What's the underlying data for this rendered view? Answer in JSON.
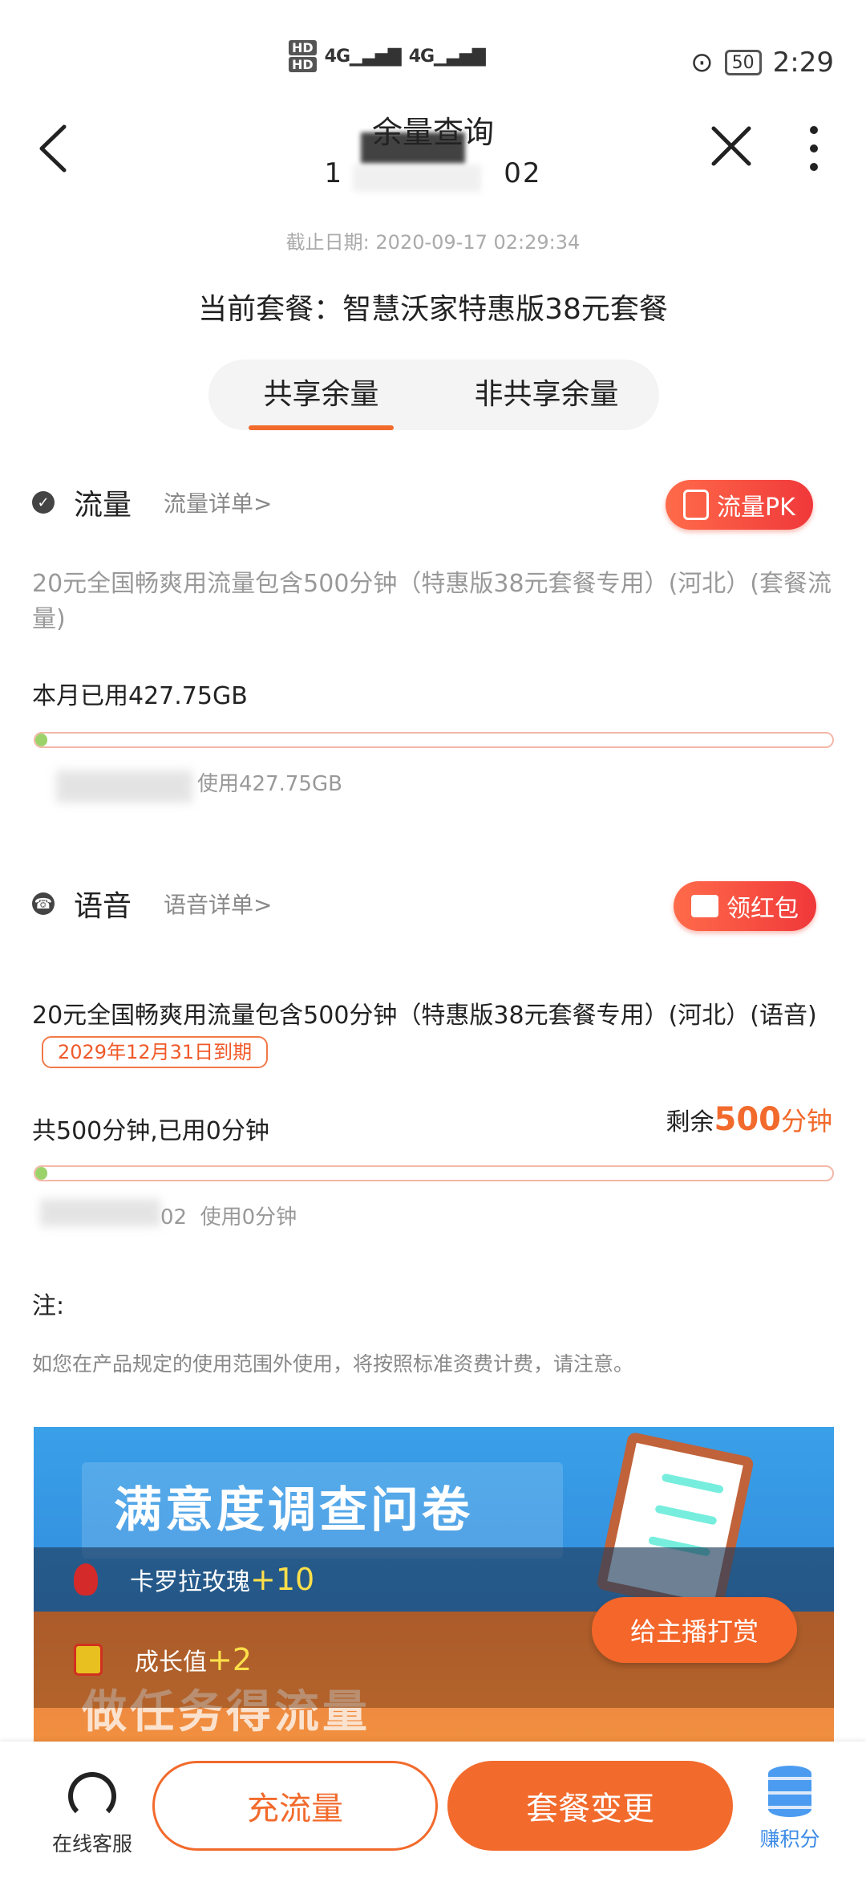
{
  "status_bar": {
    "hd1": "HD",
    "hd2": "HD",
    "signal1": "4G",
    "signal2": "4G",
    "battery": "50",
    "time": "2:29"
  },
  "header": {
    "title": "余量查询",
    "phone_start": "1",
    "phone_end": "02"
  },
  "cutoff": {
    "label": "截止日期:",
    "value": "2020-09-17 02:29:34"
  },
  "package": "当前套餐：智慧沃家特惠版38元套餐",
  "tabs": [
    {
      "label": "共享余量",
      "active": true
    },
    {
      "label": "非共享余量",
      "active": false
    }
  ],
  "data_section": {
    "title": "流量",
    "link": "流量详单>",
    "pill": "流量PK",
    "description": "20元全国畅爽用流量包含500分钟（特惠版38元套餐专用）(河北）(套餐流量)",
    "used_text": "本月已用427.75GB",
    "progress": 0.01,
    "bar_note": "使用427.75GB"
  },
  "voice_section": {
    "title": "语音",
    "link": "语音详单>",
    "pill": "领红包",
    "description": "20元全国畅爽用流量包含500分钟（特惠版38元套餐专用）(河北）(语音)",
    "expire": "2029年12月31日到期",
    "used_text": "共500分钟,已用0分钟",
    "remain_prefix": "剩余",
    "remain_value": "500",
    "remain_unit": "分钟",
    "progress": 0.01,
    "bar_note_prefix": "02",
    "bar_note": "使用0分钟"
  },
  "note": {
    "heading": "注:",
    "text": "如您在产品规定的使用范围外使用，将按照标准资费计费，请注意。"
  },
  "banner": {
    "title": "满意度调查问卷",
    "subtitle": "做任务得流量",
    "gift1_name": "卡罗拉玫瑰",
    "gift1_plus": "+10",
    "gift2_name": "成长值",
    "gift2_plus": "+2",
    "reward_button": "给主播打赏"
  },
  "bottom_nav": {
    "customer_service": "在线客服",
    "charge": "充流量",
    "change": "套餐变更",
    "points": "赚积分"
  }
}
